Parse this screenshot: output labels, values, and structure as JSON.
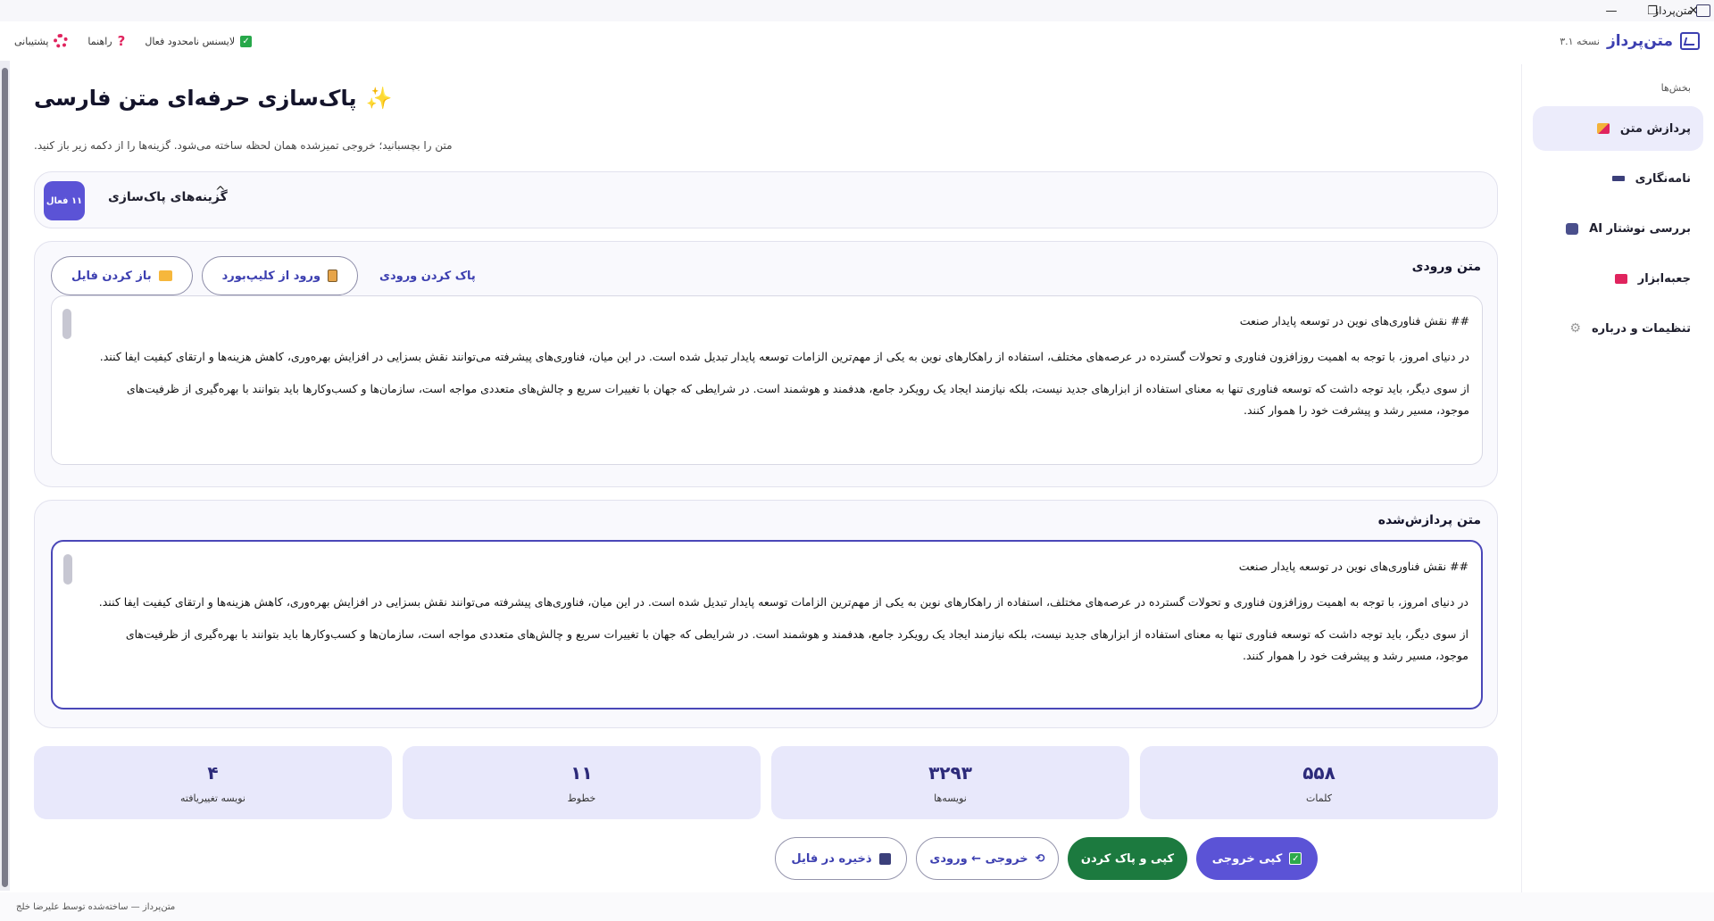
{
  "window": {
    "title": "متن‌پرداز",
    "controls": [
      "—",
      "❐",
      "✕"
    ]
  },
  "header": {
    "brand_name": "متن‌پرداز",
    "version": "نسخه ۳.۱",
    "license": "لایسنس نامحدود فعال",
    "help": "راهنما",
    "support": "پشتیبانی"
  },
  "sidebar": {
    "section_title": "بخش‌ها",
    "items": [
      {
        "label": "پردازش متن",
        "icon": "pencil-icon",
        "color": "#e0245e"
      },
      {
        "label": "نامه‌نگاری",
        "icon": "envelope-icon",
        "color": "#3b3f7a"
      },
      {
        "label": "بررسی نوشتار AI",
        "icon": "robot-icon",
        "color": "#4a4f8c"
      },
      {
        "label": "جعبه‌ابزار",
        "icon": "toolbox-icon",
        "color": "#e0245e"
      },
      {
        "label": "تنظیمات و درباره",
        "icon": "gear-icon",
        "color": "#888888"
      }
    ]
  },
  "page": {
    "title": "پاک‌سازی حرفه‌ای متن فارسی",
    "subtitle": "متن را بچسبانید؛ خروجی تمیزشده همان لحظه ساخته می‌شود. گزینه‌ها را از دکمه زیر باز کنید."
  },
  "options": {
    "label": "گزینه‌های پاک‌سازی",
    "caret": "^",
    "badge": "۱۱ فعال"
  },
  "input": {
    "title": "متن ورودی",
    "clear_label": "پاک کردن ورودی",
    "clipboard_label": "ورود از کلیپ‌بورد",
    "open_file_label": "باز کردن فایل",
    "paragraphs": [
      "## نقش فناوری‌های نوین در توسعه پایدار صنعت",
      "در دنیای امروز، با توجه به اهمیت روزافزون فناوری و تحولات گسترده در عرصه‌های مختلف، استفاده از راهکارهای نوین به یکی از مهم‌ترین الزامات توسعه پایدار تبدیل شده است. در این میان، فناوری‌های پیشرفته می‌توانند نقش بسزایی در افزایش بهره‌وری، کاهش هزینه‌ها و ارتقای کیفیت ایفا کنند.",
      "از سوی دیگر، باید توجه داشت که توسعه فناوری تنها به معنای استفاده از ابزارهای جدید نیست، بلکه نیازمند ایجاد یک رویکرد جامع، هدفمند و هوشمند است. در شرایطی که جهان با تغییرات سریع و چالش‌های متعددی مواجه است، سازمان‌ها و کسب‌وکارها باید بتوانند با بهره‌گیری از ظرفیت‌های موجود، مسیر رشد و پیشرفت خود را هموار کنند."
    ]
  },
  "output": {
    "title": "متن پردازش‌شده",
    "paragraphs": [
      "## نقش فناوری‌های نوین در توسعه پایدار صنعت",
      "در دنیای امروز، با توجه به اهمیت روزافزون فناوری و تحولات گسترده در عرصه‌های مختلف، استفاده از راهکارهای نوین به یکی از مهم‌ترین الزامات توسعه پایدار تبدیل شده است. در این میان، فناوری‌های پیشرفته می‌توانند نقش بسزایی در افزایش بهره‌وری، کاهش هزینه‌ها و ارتقای کیفیت ایفا کنند.",
      "از سوی دیگر، باید توجه داشت که توسعه فناوری تنها به معنای استفاده از ابزارهای جدید نیست، بلکه نیازمند ایجاد یک رویکرد جامع، هدفمند و هوشمند است. در شرایطی که جهان با تغییرات سریع و چالش‌های متعددی مواجه است، سازمان‌ها و کسب‌وکارها باید بتوانند با بهره‌گیری از ظرفیت‌های موجود، مسیر رشد و پیشرفت خود را هموار کنند."
    ]
  },
  "stats": [
    {
      "label": "نویسه تغییریافته",
      "value": "۴"
    },
    {
      "label": "خطوط",
      "value": "۱۱"
    },
    {
      "label": "نویسه‌ها",
      "value": "۳۲۹۳"
    },
    {
      "label": "کلمات",
      "value": "۵۵۸"
    }
  ],
  "actions": {
    "save_file": "ذخیره در فایل",
    "output_to_input": "خروجی ← ورودی",
    "copy_and_clear": "کپی و پاک کردن",
    "copy_output": "کپی خروجی"
  },
  "footer": {
    "text": "متن‌پرداز — ساخته‌شده توسط علیرضا خلج"
  },
  "colors": {
    "accent": "#5b53d6",
    "green": "#1c7a3f",
    "danger": "#e0245e"
  }
}
